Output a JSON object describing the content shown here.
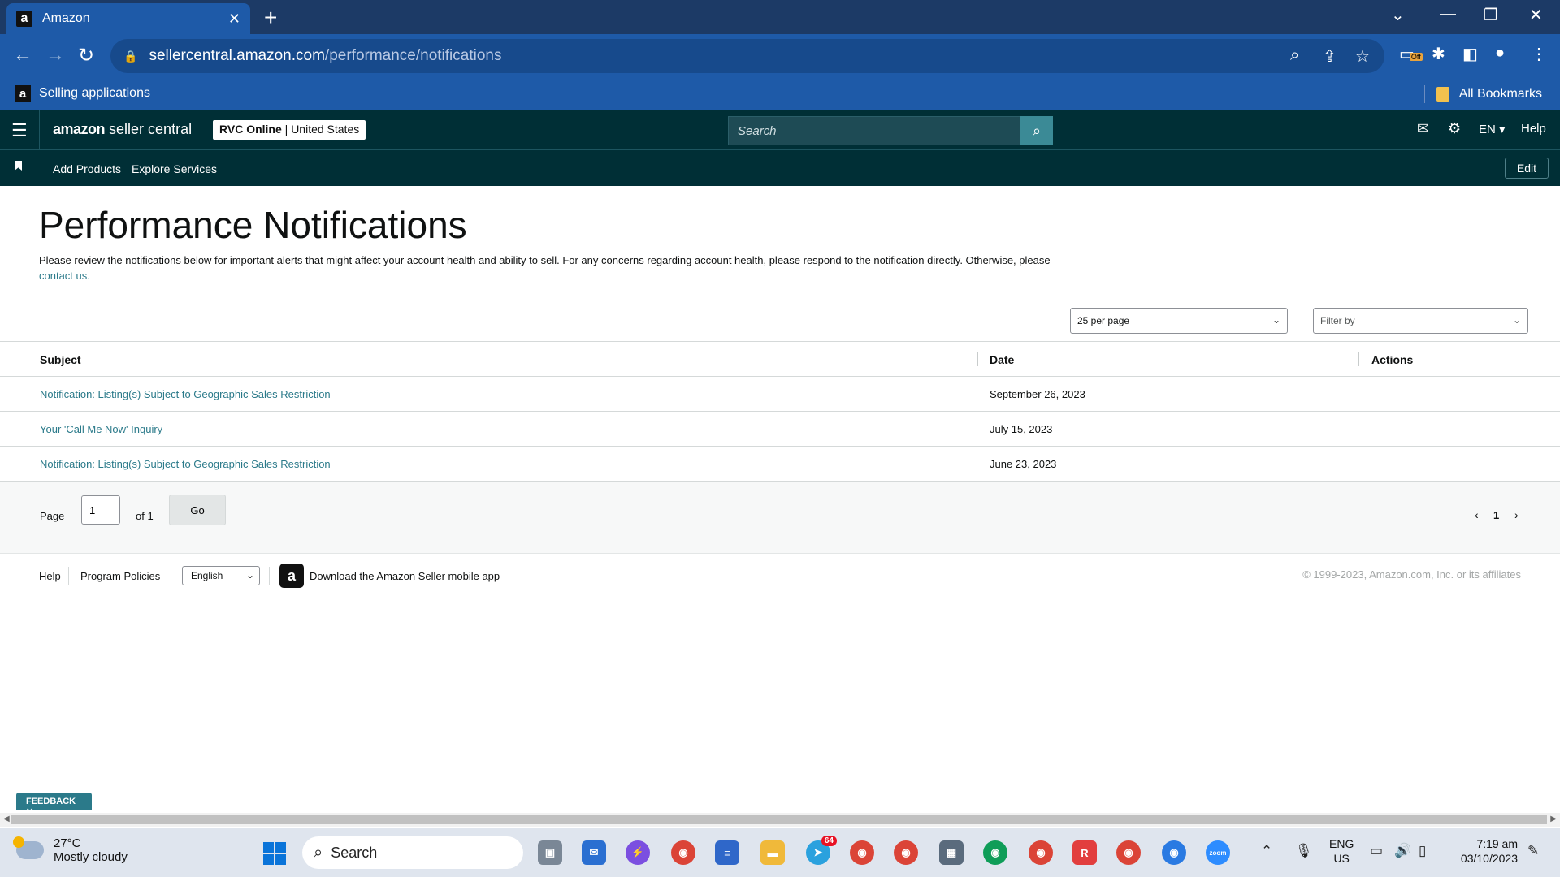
{
  "browser": {
    "tab_title": "Amazon",
    "url_host": "sellercentral.amazon.com",
    "url_path": "/performance/notifications",
    "bookmarks": {
      "left": "Selling applications",
      "right": "All Bookmarks"
    },
    "extension_badge": "Off"
  },
  "header": {
    "logo_bold": "amazon",
    "logo_rest": " seller central",
    "account_name": "RVC Online",
    "account_region": "United States",
    "search_placeholder": "Search",
    "language": "EN",
    "help": "Help"
  },
  "subnav": {
    "links": [
      "Add Products",
      "Explore Services"
    ],
    "edit": "Edit"
  },
  "main": {
    "title": "Performance Notifications",
    "description": "Please review the notifications below for important alerts that might affect your account health and ability to sell. For any concerns regarding account health, please respond to the notification directly. Otherwise, please",
    "contact_link": "contact us.",
    "per_page": "25 per page",
    "filter_placeholder": "Filter by",
    "table": {
      "headers": [
        "Subject",
        "Date",
        "Actions"
      ],
      "rows": [
        {
          "subject": "Notification: Listing(s) Subject to Geographic Sales Restriction",
          "date": "September 26, 2023",
          "actions": ""
        },
        {
          "subject": "Your 'Call Me Now' Inquiry",
          "date": "July 15, 2023",
          "actions": ""
        },
        {
          "subject": "Notification: Listing(s) Subject to Geographic Sales Restriction",
          "date": "June 23, 2023",
          "actions": ""
        }
      ]
    },
    "pager": {
      "page_label": "Page",
      "page_value": "1",
      "of_label": "of 1",
      "go": "Go",
      "current": "1"
    }
  },
  "footer": {
    "help": "Help",
    "policies": "Program Policies",
    "language": "English",
    "app_link": "Download the Amazon Seller mobile app",
    "copyright": "© 1999-2023, Amazon.com, Inc. or its affiliates"
  },
  "feedback": "FEEDBACK",
  "taskbar": {
    "temp": "27°C",
    "weather": "Mostly cloudy",
    "search": "Search",
    "telegram_badge": "64",
    "lang_top": "ENG",
    "lang_bottom": "US",
    "time": "7:19 am",
    "date": "03/10/2023"
  }
}
